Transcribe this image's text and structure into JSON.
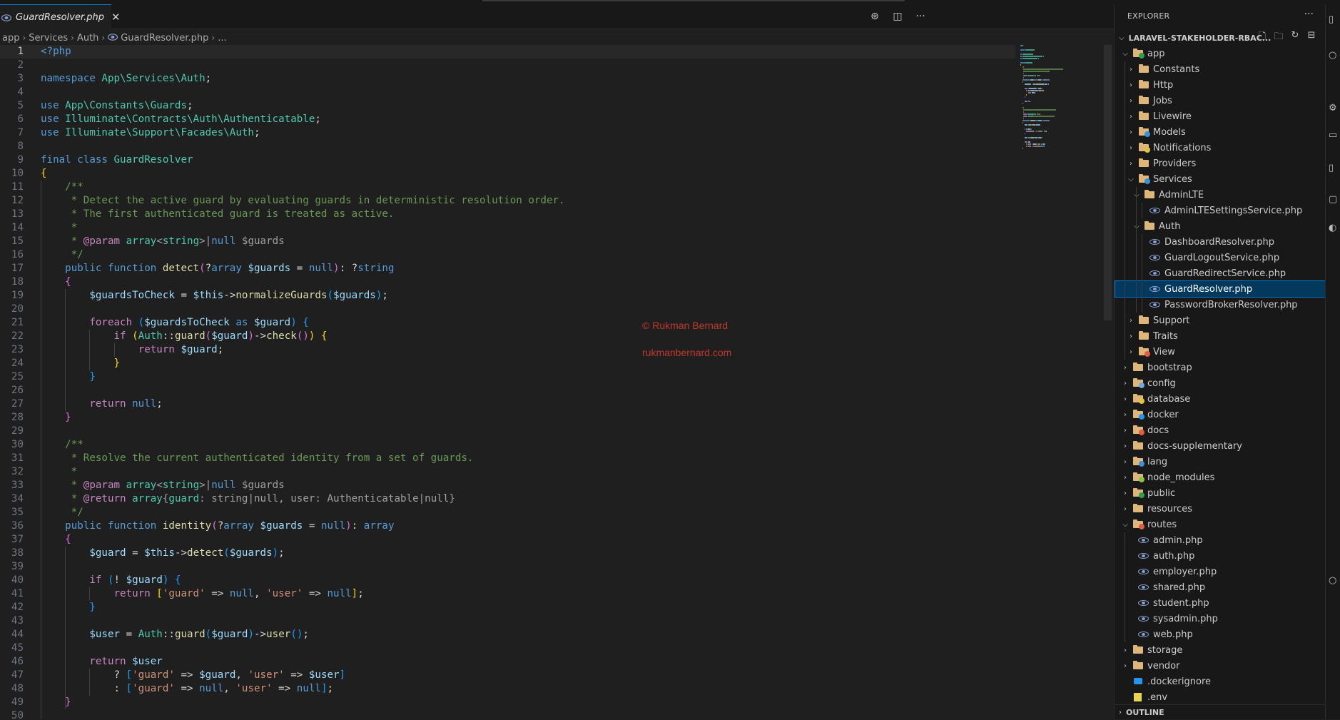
{
  "editor": {
    "tab": {
      "title": "GuardResolver.php",
      "close": "✕",
      "icon": "php-file-icon"
    },
    "actions": [
      {
        "name": "copilot-icon",
        "glyph": "⊛"
      },
      {
        "name": "split-editor-icon",
        "glyph": "◫"
      },
      {
        "name": "more-actions-icon",
        "glyph": "···"
      }
    ],
    "breadcrumb": [
      "app",
      "Services",
      "Auth",
      "GuardResolver.php",
      "..."
    ],
    "active_line": 1,
    "line_count": 50
  },
  "watermark": {
    "line1": "© Rukman Bernard",
    "line2": "rukmanbernard.com"
  },
  "explorer": {
    "title": "EXPLORER",
    "more": "···",
    "project": "LARAVEL-STAKEHOLDER-RBAC...",
    "project_actions": [
      "new-file-icon",
      "new-folder-icon",
      "refresh-icon",
      "collapse-all-icon"
    ],
    "tree": [
      {
        "label": "app",
        "depth": 0,
        "type": "folder",
        "open": true,
        "badge": "#2ea043"
      },
      {
        "label": "Constants",
        "depth": 1,
        "type": "folder",
        "open": false
      },
      {
        "label": "Http",
        "depth": 1,
        "type": "folder",
        "open": false
      },
      {
        "label": "Jobs",
        "depth": 1,
        "type": "folder",
        "open": false
      },
      {
        "label": "Livewire",
        "depth": 1,
        "type": "folder",
        "open": false
      },
      {
        "label": "Models",
        "depth": 1,
        "type": "folder",
        "open": false,
        "badge": "#3d8fd6"
      },
      {
        "label": "Notifications",
        "depth": 1,
        "type": "folder",
        "open": false,
        "badge": "#e0c341"
      },
      {
        "label": "Providers",
        "depth": 1,
        "type": "folder",
        "open": false
      },
      {
        "label": "Services",
        "depth": 1,
        "type": "folder",
        "open": true,
        "badge": "#3d8fd6"
      },
      {
        "label": "AdminLTE",
        "depth": 2,
        "type": "folder",
        "open": true
      },
      {
        "label": "AdminLTESettingsService.php",
        "depth": 3,
        "type": "php"
      },
      {
        "label": "Auth",
        "depth": 2,
        "type": "folder",
        "open": true
      },
      {
        "label": "DashboardResolver.php",
        "depth": 3,
        "type": "php"
      },
      {
        "label": "GuardLogoutService.php",
        "depth": 3,
        "type": "php"
      },
      {
        "label": "GuardRedirectService.php",
        "depth": 3,
        "type": "php"
      },
      {
        "label": "GuardResolver.php",
        "depth": 3,
        "type": "php",
        "selected": true
      },
      {
        "label": "PasswordBrokerResolver.php",
        "depth": 3,
        "type": "php"
      },
      {
        "label": "Support",
        "depth": 1,
        "type": "folder",
        "open": false
      },
      {
        "label": "Traits",
        "depth": 1,
        "type": "folder",
        "open": false
      },
      {
        "label": "View",
        "depth": 1,
        "type": "folder",
        "open": false,
        "badge": "#e05d44"
      },
      {
        "label": "bootstrap",
        "depth": 0,
        "type": "folder",
        "open": false
      },
      {
        "label": "config",
        "depth": 0,
        "type": "folder",
        "open": false,
        "badge": "#6fa8dc"
      },
      {
        "label": "database",
        "depth": 0,
        "type": "folder",
        "open": false,
        "badge": "#e0c341"
      },
      {
        "label": "docker",
        "depth": 0,
        "type": "folder",
        "open": false,
        "badge": "#2496ed"
      },
      {
        "label": "docs",
        "depth": 0,
        "type": "folder",
        "open": false,
        "badge": "#e05d44"
      },
      {
        "label": "docs-supplementary",
        "depth": 0,
        "type": "folder",
        "open": false
      },
      {
        "label": "lang",
        "depth": 0,
        "type": "folder",
        "open": false,
        "badge": "#3d8fd6"
      },
      {
        "label": "node_modules",
        "depth": 0,
        "type": "folder",
        "open": false,
        "badge": "#8bc34a"
      },
      {
        "label": "public",
        "depth": 0,
        "type": "folder",
        "open": false,
        "badge": "#2ea043"
      },
      {
        "label": "resources",
        "depth": 0,
        "type": "folder",
        "open": false
      },
      {
        "label": "routes",
        "depth": 0,
        "type": "folder",
        "open": true,
        "badge": "#e05d44"
      },
      {
        "label": "admin.php",
        "depth": 1,
        "type": "php"
      },
      {
        "label": "auth.php",
        "depth": 1,
        "type": "php"
      },
      {
        "label": "employer.php",
        "depth": 1,
        "type": "php"
      },
      {
        "label": "shared.php",
        "depth": 1,
        "type": "php"
      },
      {
        "label": "student.php",
        "depth": 1,
        "type": "php"
      },
      {
        "label": "sysadmin.php",
        "depth": 1,
        "type": "php"
      },
      {
        "label": "web.php",
        "depth": 1,
        "type": "php"
      },
      {
        "label": "storage",
        "depth": 0,
        "type": "folder",
        "open": false
      },
      {
        "label": "vendor",
        "depth": 0,
        "type": "folder",
        "open": false
      },
      {
        "label": ".dockerignore",
        "depth": 0,
        "type": "docker"
      },
      {
        "label": ".env",
        "depth": 0,
        "type": "env"
      }
    ],
    "outline": "OUTLINE"
  },
  "code": [
    [
      [
        "tg",
        "<?php"
      ]
    ],
    [],
    [
      [
        "kw",
        "namespace "
      ],
      [
        "ty",
        "App\\Services\\Auth"
      ],
      [
        "pn",
        ";"
      ]
    ],
    [],
    [
      [
        "kw",
        "use "
      ],
      [
        "ty",
        "App\\Constants\\Guards"
      ],
      [
        "pn",
        ";"
      ]
    ],
    [
      [
        "kw",
        "use "
      ],
      [
        "ty",
        "Illuminate\\Contracts\\Auth\\Authenticatable"
      ],
      [
        "pn",
        ";"
      ]
    ],
    [
      [
        "kw",
        "use "
      ],
      [
        "ty",
        "Illuminate\\Support\\Facades\\Auth"
      ],
      [
        "pn",
        ";"
      ]
    ],
    [],
    [
      [
        "kw",
        "final class "
      ],
      [
        "ty",
        "GuardResolver"
      ]
    ],
    [
      [
        "b1",
        "{"
      ]
    ],
    [
      [
        "cm",
        "    /**"
      ]
    ],
    [
      [
        "cm",
        "     * Detect the active guard by evaluating guards in deterministic resolution order."
      ]
    ],
    [
      [
        "cm",
        "     * The first authenticated guard is treated as active."
      ]
    ],
    [
      [
        "cm",
        "     *"
      ]
    ],
    [
      [
        "cm",
        "     * "
      ],
      [
        "kwc",
        "@param "
      ],
      [
        "ty",
        "array"
      ],
      [
        "cmd",
        "<"
      ],
      [
        "ty",
        "string"
      ],
      [
        "cmd",
        ">|"
      ],
      [
        "kw",
        "null "
      ],
      [
        "cmd",
        "$guards"
      ]
    ],
    [
      [
        "cm",
        "     */"
      ]
    ],
    [
      [
        "kw",
        "    public function "
      ],
      [
        "fn",
        "detect"
      ],
      [
        "b2",
        "("
      ],
      [
        "pn",
        "?"
      ],
      [
        "kw",
        "array "
      ],
      [
        "vr",
        "$guards "
      ],
      [
        "pn",
        "= "
      ],
      [
        "kw",
        "null"
      ],
      [
        "b2",
        ")"
      ],
      [
        "pn",
        ": ?"
      ],
      [
        "kw",
        "string"
      ]
    ],
    [
      [
        "b2",
        "    {"
      ]
    ],
    [
      [
        "vr",
        "        $guardsToCheck "
      ],
      [
        "pn",
        "= "
      ],
      [
        "vr",
        "$this"
      ],
      [
        "pn",
        "->"
      ],
      [
        "fn",
        "normalizeGuards"
      ],
      [
        "b3",
        "("
      ],
      [
        "vr",
        "$guards"
      ],
      [
        "b3",
        ")"
      ],
      [
        "pn",
        ";"
      ]
    ],
    [],
    [
      [
        "kwc",
        "        foreach "
      ],
      [
        "b3",
        "("
      ],
      [
        "vr",
        "$guardsToCheck "
      ],
      [
        "kw",
        "as "
      ],
      [
        "vr",
        "$guard"
      ],
      [
        "b3",
        ") {"
      ]
    ],
    [
      [
        "kwc",
        "            if "
      ],
      [
        "b1",
        "("
      ],
      [
        "ty",
        "Auth"
      ],
      [
        "pn",
        "::"
      ],
      [
        "fn",
        "guard"
      ],
      [
        "b2",
        "("
      ],
      [
        "vr",
        "$guard"
      ],
      [
        "b2",
        ")"
      ],
      [
        "pn",
        "->"
      ],
      [
        "fn",
        "check"
      ],
      [
        "b2",
        "()"
      ],
      [
        "b1",
        ") {"
      ]
    ],
    [
      [
        "kwc",
        "                return "
      ],
      [
        "vr",
        "$guard"
      ],
      [
        "pn",
        ";"
      ]
    ],
    [
      [
        "b1",
        "            }"
      ]
    ],
    [
      [
        "b3",
        "        }"
      ]
    ],
    [],
    [
      [
        "kwc",
        "        return "
      ],
      [
        "kw",
        "null"
      ],
      [
        "pn",
        ";"
      ]
    ],
    [
      [
        "b2",
        "    }"
      ]
    ],
    [],
    [
      [
        "cm",
        "    /**"
      ]
    ],
    [
      [
        "cm",
        "     * Resolve the current authenticated identity from a set of guards."
      ]
    ],
    [
      [
        "cm",
        "     *"
      ]
    ],
    [
      [
        "cm",
        "     * "
      ],
      [
        "kwc",
        "@param "
      ],
      [
        "ty",
        "array"
      ],
      [
        "cmd",
        "<"
      ],
      [
        "ty",
        "string"
      ],
      [
        "cmd",
        ">|"
      ],
      [
        "kw",
        "null "
      ],
      [
        "cmd",
        "$guards"
      ]
    ],
    [
      [
        "cm",
        "     * "
      ],
      [
        "kwc",
        "@return "
      ],
      [
        "ty",
        "array"
      ],
      [
        "cmd",
        "{"
      ],
      [
        "ty",
        "guard"
      ],
      [
        "cmd",
        ": string|null, user: Authenticatable|null}"
      ]
    ],
    [
      [
        "cm",
        "     */"
      ]
    ],
    [
      [
        "kw",
        "    public function "
      ],
      [
        "fn",
        "identity"
      ],
      [
        "b2",
        "("
      ],
      [
        "pn",
        "?"
      ],
      [
        "kw",
        "array "
      ],
      [
        "vr",
        "$guards "
      ],
      [
        "pn",
        "= "
      ],
      [
        "kw",
        "null"
      ],
      [
        "b2",
        ")"
      ],
      [
        "pn",
        ": "
      ],
      [
        "kw",
        "array"
      ]
    ],
    [
      [
        "b2",
        "    {"
      ]
    ],
    [
      [
        "vr",
        "        $guard "
      ],
      [
        "pn",
        "= "
      ],
      [
        "vr",
        "$this"
      ],
      [
        "pn",
        "->"
      ],
      [
        "fn",
        "detect"
      ],
      [
        "b3",
        "("
      ],
      [
        "vr",
        "$guards"
      ],
      [
        "b3",
        ")"
      ],
      [
        "pn",
        ";"
      ]
    ],
    [],
    [
      [
        "kwc",
        "        if "
      ],
      [
        "b3",
        "("
      ],
      [
        "pn",
        "! "
      ],
      [
        "vr",
        "$guard"
      ],
      [
        "b3",
        ") {"
      ]
    ],
    [
      [
        "kwc",
        "            return "
      ],
      [
        "b1",
        "["
      ],
      [
        "st",
        "'guard' "
      ],
      [
        "pn",
        "=> "
      ],
      [
        "kw",
        "null"
      ],
      [
        "pn",
        ", "
      ],
      [
        "st",
        "'user' "
      ],
      [
        "pn",
        "=> "
      ],
      [
        "kw",
        "null"
      ],
      [
        "b1",
        "]"
      ],
      [
        "pn",
        ";"
      ]
    ],
    [
      [
        "b3",
        "        }"
      ]
    ],
    [],
    [
      [
        "vr",
        "        $user "
      ],
      [
        "pn",
        "= "
      ],
      [
        "ty",
        "Auth"
      ],
      [
        "pn",
        "::"
      ],
      [
        "fn",
        "guard"
      ],
      [
        "b3",
        "("
      ],
      [
        "vr",
        "$guard"
      ],
      [
        "b3",
        ")"
      ],
      [
        "pn",
        "->"
      ],
      [
        "fn",
        "user"
      ],
      [
        "b3",
        "()"
      ],
      [
        "pn",
        ";"
      ]
    ],
    [],
    [
      [
        "kwc",
        "        return "
      ],
      [
        "vr",
        "$user"
      ]
    ],
    [
      [
        "pn",
        "            ? "
      ],
      [
        "b3",
        "["
      ],
      [
        "st",
        "'guard' "
      ],
      [
        "pn",
        "=> "
      ],
      [
        "vr",
        "$guard"
      ],
      [
        "pn",
        ", "
      ],
      [
        "st",
        "'user' "
      ],
      [
        "pn",
        "=> "
      ],
      [
        "vr",
        "$user"
      ],
      [
        "b3",
        "]"
      ]
    ],
    [
      [
        "pn",
        "            : "
      ],
      [
        "b3",
        "["
      ],
      [
        "st",
        "'guard' "
      ],
      [
        "pn",
        "=> "
      ],
      [
        "kw",
        "null"
      ],
      [
        "pn",
        ", "
      ],
      [
        "st",
        "'user' "
      ],
      [
        "pn",
        "=> "
      ],
      [
        "kw",
        "null"
      ],
      [
        "b3",
        "]"
      ],
      [
        "pn",
        ";"
      ]
    ],
    [
      [
        "b2",
        "    }"
      ]
    ],
    []
  ]
}
